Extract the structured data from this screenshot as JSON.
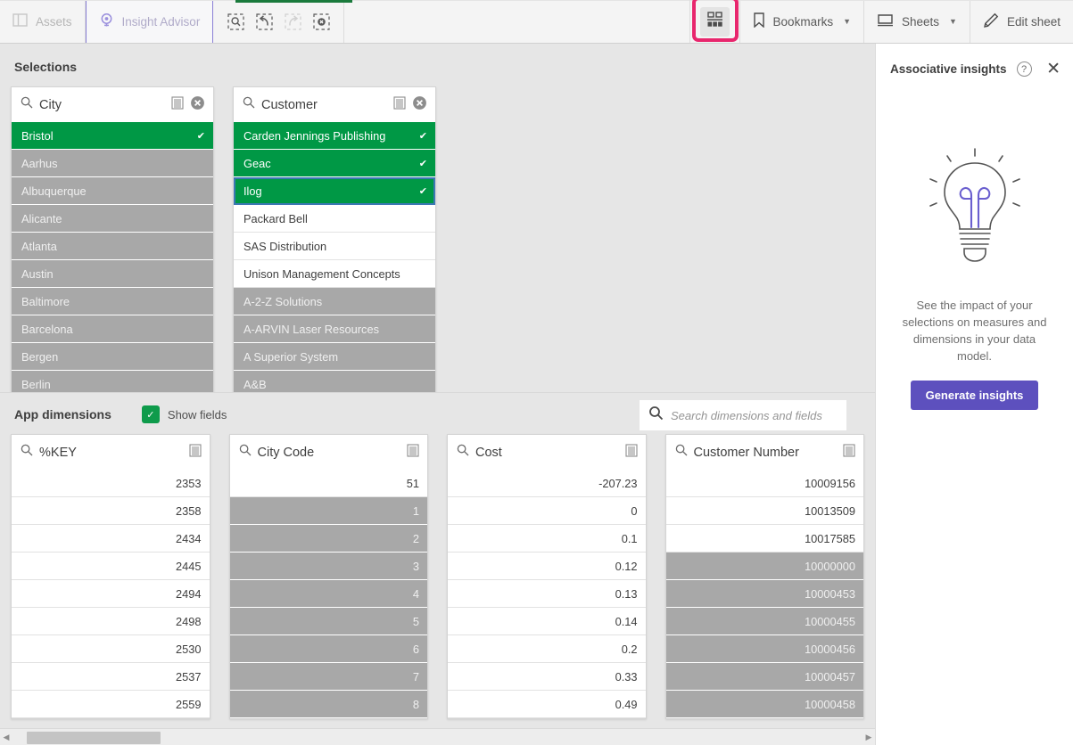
{
  "toolbar": {
    "assets_label": "Assets",
    "insight_advisor_label": "Insight Advisor",
    "bookmarks_label": "Bookmarks",
    "sheets_label": "Sheets",
    "edit_sheet_label": "Edit sheet",
    "icons": {
      "assets": "panel-icon",
      "insight_advisor": "insight-advisor-icon",
      "selection_search": "selection-search-icon",
      "step_back": "step-back-icon",
      "step_forward": "step-forward-icon",
      "clear_all": "clear-all-selections-icon",
      "selections_tool": "selections-tool-icon",
      "bookmark": "bookmark-icon",
      "sheet": "sheet-icon",
      "edit": "pencil-icon"
    },
    "highlight_color": "#e8266d",
    "accent_color": "#1a7a3c"
  },
  "selections": {
    "title": "Selections",
    "listboxes": [
      {
        "field": "City",
        "items": [
          {
            "value": "Bristol",
            "state": "selected"
          },
          {
            "value": "Aarhus",
            "state": "excluded"
          },
          {
            "value": "Albuquerque",
            "state": "excluded"
          },
          {
            "value": "Alicante",
            "state": "excluded"
          },
          {
            "value": "Atlanta",
            "state": "excluded"
          },
          {
            "value": "Austin",
            "state": "excluded"
          },
          {
            "value": "Baltimore",
            "state": "excluded"
          },
          {
            "value": "Barcelona",
            "state": "excluded"
          },
          {
            "value": "Bergen",
            "state": "excluded"
          },
          {
            "value": "Berlin",
            "state": "excluded"
          }
        ]
      },
      {
        "field": "Customer",
        "items": [
          {
            "value": "Carden Jennings Publishing",
            "state": "selected"
          },
          {
            "value": "Geac",
            "state": "selected"
          },
          {
            "value": "Ilog",
            "state": "selected",
            "focused": true
          },
          {
            "value": "Packard Bell",
            "state": "avail"
          },
          {
            "value": "SAS Distribution",
            "state": "avail"
          },
          {
            "value": "Unison Management Concepts",
            "state": "avail"
          },
          {
            "value": "A-2-Z Solutions",
            "state": "excluded"
          },
          {
            "value": "A-ARVIN Laser Resources",
            "state": "excluded"
          },
          {
            "value": "A Superior System",
            "state": "excluded"
          },
          {
            "value": "A&B",
            "state": "excluded"
          }
        ]
      }
    ]
  },
  "app_dimensions": {
    "title": "App dimensions",
    "show_fields_label": "Show fields",
    "show_fields_checked": true,
    "search_placeholder": "Search dimensions and fields",
    "search_value": "",
    "fields": [
      {
        "field": "%KEY",
        "items": [
          {
            "value": "2353",
            "state": "avail"
          },
          {
            "value": "2358",
            "state": "avail"
          },
          {
            "value": "2434",
            "state": "avail"
          },
          {
            "value": "2445",
            "state": "avail"
          },
          {
            "value": "2494",
            "state": "avail"
          },
          {
            "value": "2498",
            "state": "avail"
          },
          {
            "value": "2530",
            "state": "avail"
          },
          {
            "value": "2537",
            "state": "avail"
          },
          {
            "value": "2559",
            "state": "avail"
          }
        ]
      },
      {
        "field": "City Code",
        "items": [
          {
            "value": "51",
            "state": "avail"
          },
          {
            "value": "1",
            "state": "excluded"
          },
          {
            "value": "2",
            "state": "excluded"
          },
          {
            "value": "3",
            "state": "excluded"
          },
          {
            "value": "4",
            "state": "excluded"
          },
          {
            "value": "5",
            "state": "excluded"
          },
          {
            "value": "6",
            "state": "excluded"
          },
          {
            "value": "7",
            "state": "excluded"
          },
          {
            "value": "8",
            "state": "excluded"
          }
        ]
      },
      {
        "field": "Cost",
        "items": [
          {
            "value": "-207.23",
            "state": "avail"
          },
          {
            "value": "0",
            "state": "avail"
          },
          {
            "value": "0.1",
            "state": "avail"
          },
          {
            "value": "0.12",
            "state": "avail"
          },
          {
            "value": "0.13",
            "state": "avail"
          },
          {
            "value": "0.14",
            "state": "avail"
          },
          {
            "value": "0.2",
            "state": "avail"
          },
          {
            "value": "0.33",
            "state": "avail"
          },
          {
            "value": "0.49",
            "state": "avail"
          }
        ]
      },
      {
        "field": "Customer Number",
        "items": [
          {
            "value": "10009156",
            "state": "avail"
          },
          {
            "value": "10013509",
            "state": "avail"
          },
          {
            "value": "10017585",
            "state": "avail"
          },
          {
            "value": "10000000",
            "state": "excluded"
          },
          {
            "value": "10000453",
            "state": "excluded"
          },
          {
            "value": "10000455",
            "state": "excluded"
          },
          {
            "value": "10000456",
            "state": "excluded"
          },
          {
            "value": "10000457",
            "state": "excluded"
          },
          {
            "value": "10000458",
            "state": "excluded"
          }
        ]
      }
    ]
  },
  "associative_insights": {
    "title": "Associative insights",
    "help_glyph": "?",
    "close_glyph": "✕",
    "description": "See the impact of your selections on measures and dimensions in your data model.",
    "button_label": "Generate insights",
    "button_color": "#5d50be",
    "illustration": "lightbulb-icon"
  },
  "colors": {
    "selected_green": "#009845",
    "excluded_gray": "#a8a8a8",
    "alternative_gray": "#dcdcdc",
    "available_white": "#ffffff"
  }
}
